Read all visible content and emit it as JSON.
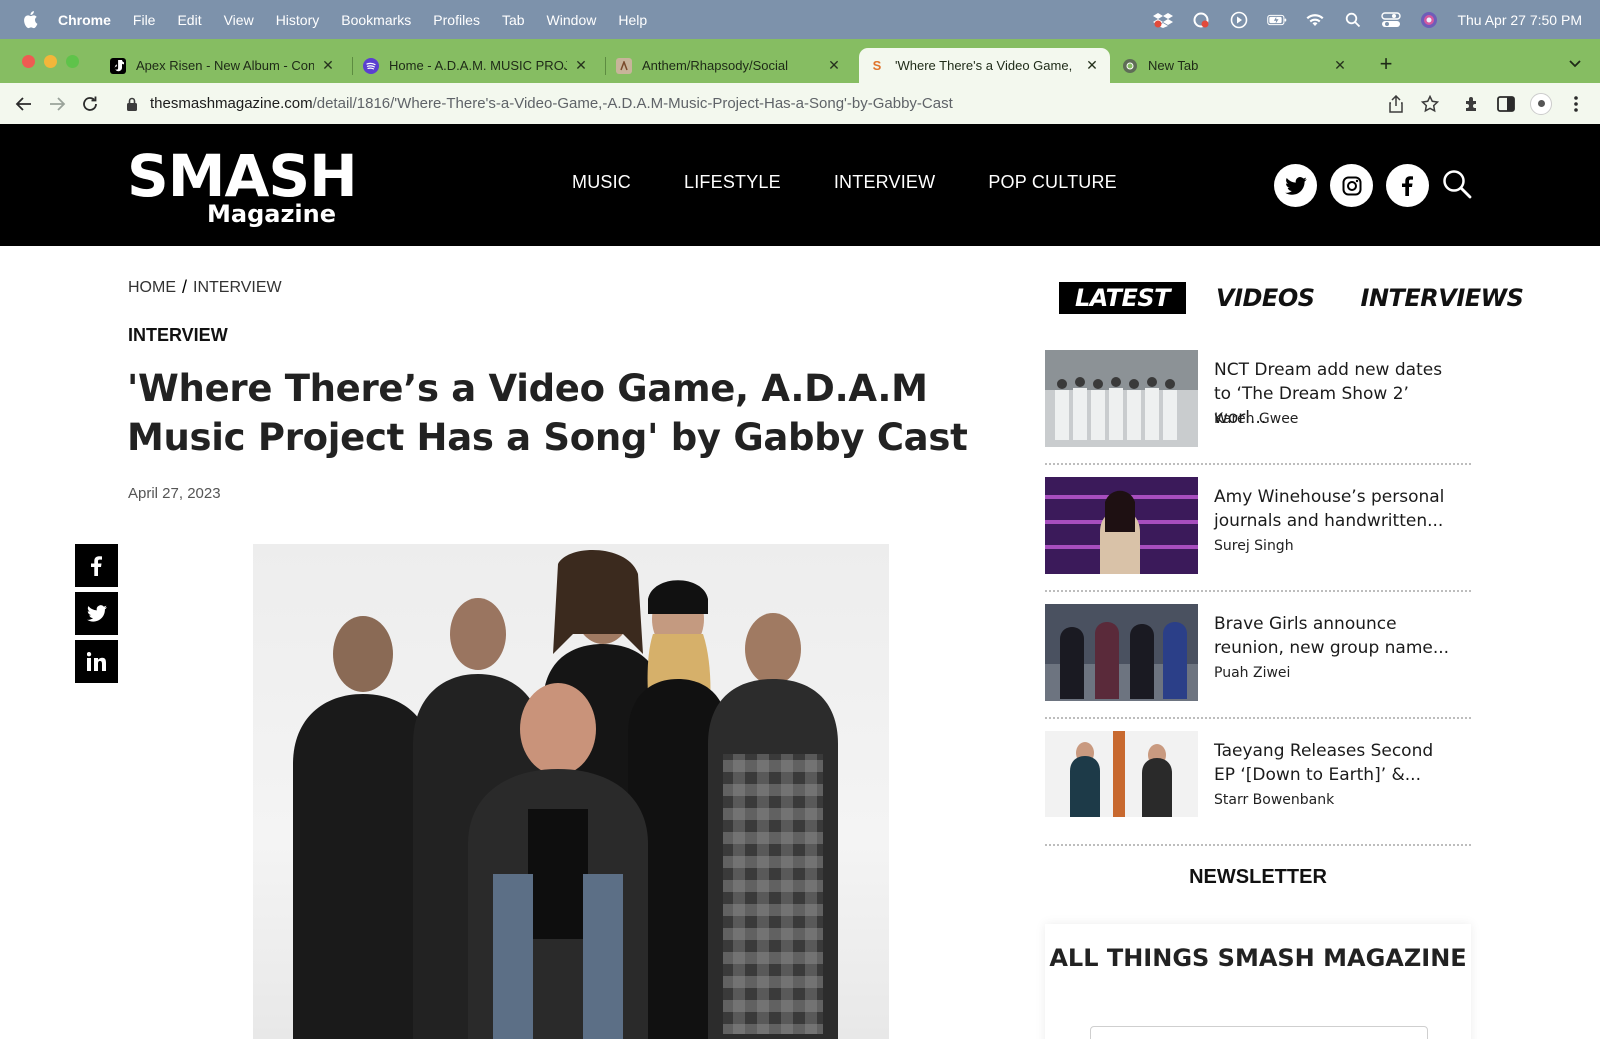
{
  "menubar": {
    "app": "Chrome",
    "items": [
      "File",
      "Edit",
      "View",
      "History",
      "Bookmarks",
      "Profiles",
      "Tab",
      "Window",
      "Help"
    ],
    "clock": "Thu Apr 27  7:50 PM"
  },
  "tabs": [
    {
      "title": "Apex Risen - New Album - Con",
      "favicon": "tiktok-icon"
    },
    {
      "title": "Home - A.D.A.M. MUSIC PROJ",
      "favicon": "spotify-icon"
    },
    {
      "title": "Anthem/Rhapsody/Social",
      "favicon": "site-icon"
    },
    {
      "title": "'Where There's a Video Game,",
      "favicon": "smash-icon",
      "active": true
    },
    {
      "title": "New Tab",
      "favicon": "chrome-icon"
    }
  ],
  "address": {
    "domain": "thesmashmagazine.com",
    "path": "/detail/1816/'Where-There's-a-Video-Game,-A.D.A.M-Music-Project-Has-a-Song'-by-Gabby-Cast"
  },
  "site": {
    "logo_main": "SMASH",
    "logo_sub": "Magazine",
    "nav": [
      "MUSIC",
      "LIFESTYLE",
      "INTERVIEW",
      "POP CULTURE"
    ]
  },
  "article": {
    "breadcrumb_home": "HOME",
    "breadcrumb_sep": "/",
    "breadcrumb_section": "INTERVIEW",
    "category": "INTERVIEW",
    "title": "'Where There’s a Video Game, A.D.A.M Music Project Has a Song' by Gabby Cast",
    "date": "April 27, 2023"
  },
  "sidebar": {
    "tabs": [
      "LATEST",
      "VIDEOS",
      "INTERVIEWS"
    ],
    "items": [
      {
        "title": "NCT Dream add new dates to ‘The Dream Show 2’ worl...",
        "author": "Karen Gwee"
      },
      {
        "title": "Amy Winehouse’s personal journals and handwritten...",
        "author": "Surej Singh"
      },
      {
        "title": "Brave Girls announce reunion, new group name...",
        "author": "Puah Ziwei"
      },
      {
        "title": "Taeyang Releases Second EP ‘[Down to Earth]’ &...",
        "author": "Starr Bowenbank"
      }
    ],
    "newsletter_label": "NEWSLETTER",
    "newsletter_title": "ALL THINGS SMASH MAGAZINE"
  }
}
